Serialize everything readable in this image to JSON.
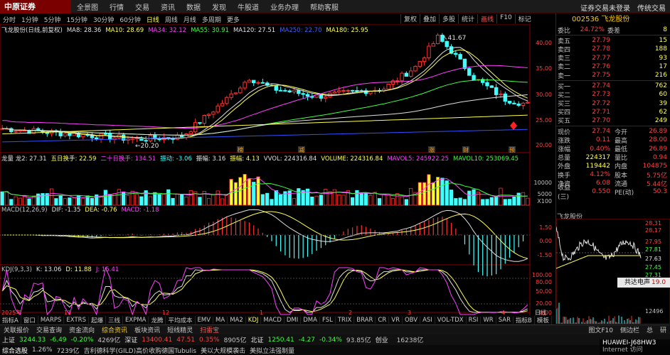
{
  "app": {
    "logo": "中原证券",
    "menu": [
      "全景图",
      "行情",
      "交易",
      "资讯",
      "数据",
      "发现",
      "牛股道",
      "业务办理",
      "帮助客服"
    ],
    "top_right": [
      "证券交易未登录",
      "传统交易"
    ]
  },
  "periods": [
    "分时",
    "1分钟",
    "5分钟",
    "15分钟",
    "30分钟",
    "60分钟",
    "日线",
    "周线",
    "月线",
    "多周期",
    "更多"
  ],
  "active_period": "日线",
  "tools": [
    "复权",
    "叠加",
    "多股",
    "统计",
    "画线",
    "F10",
    "标记"
  ],
  "main_legend": {
    "title": "飞龙股份(日线,前复权)",
    "items": [
      [
        "MA8: 28.36",
        "#e0e0e0"
      ],
      [
        "MA10: 28.69",
        "#ffff55"
      ],
      [
        "MA34: 32.12",
        "#ff40ff"
      ],
      [
        "MA55: 30.91",
        "#40ff40"
      ],
      [
        "MA120: 27.51",
        "#e0e0e0"
      ],
      [
        "MA250: 22.70",
        "#4060ff"
      ],
      [
        "MA180: 25.95",
        "#ffff55"
      ]
    ]
  },
  "main_annotations": {
    "high": "41.67",
    "low": "20.20"
  },
  "main_y": [
    "40.00",
    "35.00",
    "30.00",
    "25.00",
    "20.00"
  ],
  "event_marks": [
    "榜",
    "减",
    "涨",
    "财",
    "预"
  ],
  "vol_legend": {
    "items": [
      [
        "龙量 龙2: 27.31",
        "#e0e0e0"
      ],
      [
        "五日换手: 22.59",
        "#ffff55"
      ],
      [
        "二十日换手: 134.51",
        "#ff40ff"
      ],
      [
        "振动: -3.06",
        "#40ffff"
      ],
      [
        "振幅: 3.16",
        "#e0e0e0"
      ],
      [
        "振幅: 4.13",
        "#ffff55"
      ],
      [
        "VVOL: 224316.84",
        "#e0e0e0"
      ],
      [
        "VOLUME: 224316.84",
        "#ffff55"
      ],
      [
        "MAVOL5: 245922.25",
        "#ff40ff"
      ],
      [
        "MAVOL10: 253069.45",
        "#40ff40"
      ]
    ]
  },
  "vol_y": [
    "10000",
    "5000",
    "X100"
  ],
  "macd_legend": {
    "items": [
      [
        "MACD(12,26,9)",
        "#c0c0c0"
      ],
      [
        "DIF: -1.35",
        "#e0e0e0"
      ],
      [
        "DEA: -0.76",
        "#ffff55"
      ],
      [
        "MACD: -1.18",
        "#ff40ff"
      ]
    ]
  },
  "macd_y": [
    "1.50",
    "0.00",
    "-1.50"
  ],
  "kdj_legend": {
    "items": [
      [
        "KDJ(9,3,3)",
        "#c0c0c0"
      ],
      [
        "K: 13.06",
        "#e0e0e0"
      ],
      [
        "D: 11.88",
        "#ffff55"
      ],
      [
        "J: 15.41",
        "#ff40ff"
      ]
    ]
  },
  "kdj_y": [
    "100.00",
    "80.00",
    "50.00",
    "20.00",
    "0.00"
  ],
  "x_axis": [
    "2025年",
    "11",
    "12",
    "1",
    "2",
    "3",
    "4"
  ],
  "x_right": "日线",
  "indicator_tabs": [
    "指标A",
    "窗口",
    "MARPS",
    "EXTRS",
    "起爆",
    "三线",
    "EXPMA",
    "龙腾",
    "平均成本",
    "EMV",
    "MA",
    "MA2",
    "KDJ",
    "MACD",
    "DMI",
    "DMA",
    "FSL",
    "TRIX",
    "BRAR",
    "CR",
    "VR",
    "OBV",
    "ASI",
    "VOL-TDX",
    "RSI",
    "WR",
    "SAR",
    "指标B",
    "模板"
  ],
  "current_tab": "KDJ",
  "func_tabs": [
    "关联报价",
    "交易查询",
    "资金流向",
    "综合资讯",
    "板块资讯",
    "短线精灵",
    "扫雷宝"
  ],
  "func_right": [
    "图文F10",
    "侧边栏",
    "总",
    "研"
  ],
  "quote": {
    "code": "002536",
    "name": "飞龙股份",
    "weibi": [
      "委比",
      "24.72%",
      "委差",
      "8"
    ],
    "asks": [
      [
        "卖五",
        "27.79",
        "15"
      ],
      [
        "卖四",
        "27.78",
        "188"
      ],
      [
        "卖三",
        "27.77",
        "93"
      ],
      [
        "卖二",
        "27.76",
        "17"
      ],
      [
        "卖一",
        "27.75",
        "216"
      ]
    ],
    "bids": [
      [
        "买一",
        "27.74",
        "762"
      ],
      [
        "买二",
        "27.73",
        "60"
      ],
      [
        "买三",
        "27.72",
        "39"
      ],
      [
        "买四",
        "27.71",
        "62"
      ],
      [
        "买五",
        "27.70",
        "249"
      ]
    ],
    "stats": [
      [
        "现价",
        "27.74",
        "今开",
        "26.89"
      ],
      [
        "涨跌",
        "0.11",
        "最高",
        "28.00"
      ],
      [
        "涨幅",
        "0.40%",
        "最低",
        "26.89"
      ],
      [
        "总量",
        "224317",
        "量比",
        "0.94"
      ],
      [
        "外盘",
        "119442",
        "内盘",
        "104875"
      ],
      [
        "换手",
        "4.12%",
        "股本",
        "5.75亿"
      ],
      [
        "净资",
        "6.08",
        "流通",
        "5.44亿"
      ],
      [
        "收益(三)",
        "0.550",
        "PE(动)",
        "50.3"
      ]
    ]
  },
  "mini": {
    "title": "飞龙股份",
    "y": [
      "28.31",
      "28.17",
      "27.95",
      "27.81",
      "27.63",
      "27.45",
      "27.31"
    ],
    "vol_y": [
      "12496"
    ],
    "popup_a": "共达电声",
    "popup_b": "19.0"
  },
  "status": [
    [
      "上证",
      "3244.33",
      "-6.49",
      "-0.20%",
      "4269",
      "亿"
    ],
    [
      "深证",
      "13400.41",
      "47.51",
      "0.35%",
      "8905",
      "亿"
    ],
    [
      "北证",
      "1250.41",
      "-4.27",
      "-0.34%",
      "93.85",
      "亿"
    ],
    [
      "创业",
      "",
      "",
      "",
      "16238",
      "亿"
    ]
  ],
  "ticker": [
    [
      "综合选股",
      ""
    ],
    [
      "1.26%",
      "7239亿"
    ],
    [
      "吉利德科学(GILD)高价收购德国Tubulis",
      ""
    ],
    [
      "美以大规模袭击",
      "美拟立法强制量"
    ]
  ],
  "watermark": {
    "a": "HUAWEI-J68HW3",
    "b": "Internet 访问"
  },
  "chart_data": [
    {
      "type": "candlestick",
      "title": "飞龙股份(日线,前复权)",
      "ylim": [
        19,
        43
      ],
      "annotations": [
        "41.67",
        "20.20"
      ]
    },
    {
      "type": "bar",
      "title": "VOLUME",
      "ylim": [
        0,
        15000
      ]
    },
    {
      "type": "bar",
      "title": "MACD(12,26,9)",
      "ylim": [
        -2.5,
        2.5
      ]
    },
    {
      "type": "line",
      "title": "KDJ(9,3,3)",
      "ylim": [
        0,
        100
      ]
    }
  ]
}
